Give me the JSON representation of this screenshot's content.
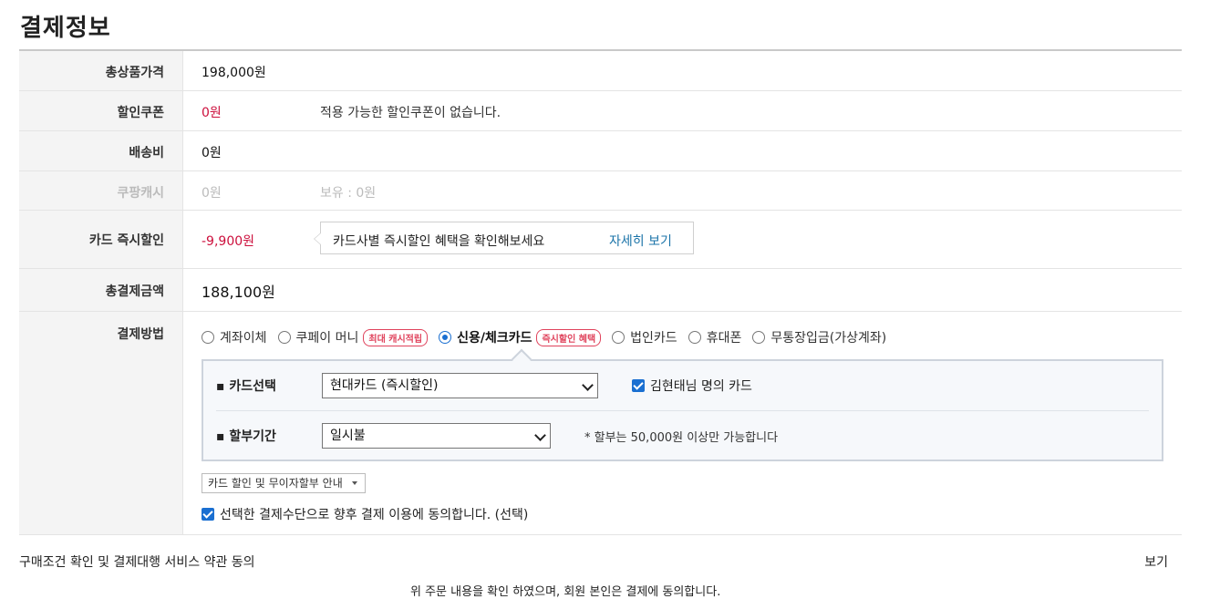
{
  "page_title": "결제정보",
  "rows": {
    "total_price": {
      "label": "총상품가격",
      "value": "198,000원"
    },
    "coupon": {
      "label": "할인쿠폰",
      "value": "0원",
      "note": "적용 가능한 할인쿠폰이 없습니다."
    },
    "shipping": {
      "label": "배송비",
      "value": "0원"
    },
    "cash": {
      "label": "쿠팡캐시",
      "value": "0원",
      "note": "보유 : 0원"
    },
    "card_discount": {
      "label": "카드 즉시할인",
      "value": "-9,900원",
      "tip_text": "카드사별 즉시할인 혜택을 확인해보세요",
      "tip_link": "자세히 보기"
    },
    "total_payment": {
      "label": "총결제금액",
      "value": "188,100원"
    },
    "payment_method": {
      "label": "결제방법"
    }
  },
  "payment_options": [
    {
      "label": "계좌이체",
      "selected": false,
      "badge": ""
    },
    {
      "label": "쿠페이 머니",
      "selected": false,
      "badge": "최대 캐시적립"
    },
    {
      "label": "신용/체크카드",
      "selected": true,
      "badge": "즉시할인 혜택"
    },
    {
      "label": "법인카드",
      "selected": false,
      "badge": ""
    },
    {
      "label": "휴대폰",
      "selected": false,
      "badge": ""
    },
    {
      "label": "무통장입금(가상계좌)",
      "selected": false,
      "badge": ""
    }
  ],
  "card_panel": {
    "card_select_label": "카드선택",
    "card_select_value": "현대카드 (즉시할인)",
    "owner_checkbox_label": "김현태님 명의 카드",
    "installment_label": "할부기간",
    "installment_value": "일시불",
    "installment_hint": "* 할부는 50,000원 이상만 가능합니다"
  },
  "guide_button": "카드 할인 및 무이자할부 안내",
  "agree_checkbox_label": "선택한 결제수단으로 향후 결제 이용에 동의합니다. (선택)",
  "terms": {
    "label": "구매조건 확인 및 결제대행 서비스 약관 동의",
    "link": "보기"
  },
  "bottom_text": "위 주문 내용을 확인 하였으며, 회원 본인은 결제에 동의합니다.",
  "colors": {
    "discount_red": "#cc0f3c",
    "badge_red": "#e0435c",
    "link_blue": "#1a73a8",
    "accent_blue": "#1a6fd1"
  }
}
